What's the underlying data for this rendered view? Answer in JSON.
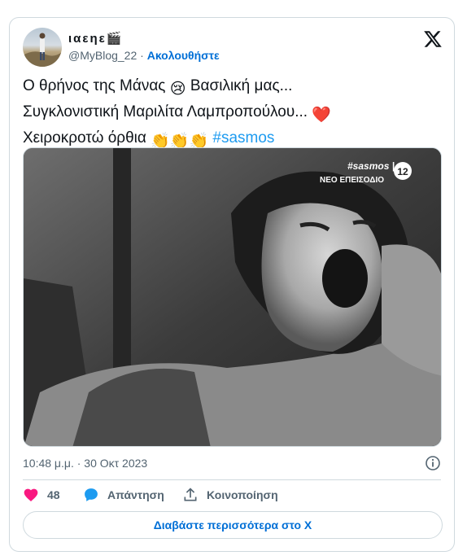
{
  "tweet": {
    "display_name": "ιαεηε🎬",
    "handle": "@MyBlog_22",
    "separator": " · ",
    "follow_label": "Ακολουθήστε",
    "text_line1": "Ο θρήνος της Μάνας ",
    "emoji1": "😢",
    "text_line1b": " Βασιλική μας...",
    "text_line2": "Συγκλονιστική Μαριλίτα Λαμπροπούλου... ",
    "emoji2": "❤️",
    "text_line3": "Χειροκροτώ όρθια ",
    "emoji3": "👏👏👏",
    "hashtag": "#sasmos",
    "timestamp": "10:48 μ.μ. · 30 Οκτ 2023"
  },
  "media": {
    "overlay_brand": "#sasmos |",
    "overlay_sub": "ΝΕΟ ΕΠΕΙΣΟΔΙΟ",
    "rating": "12"
  },
  "actions": {
    "like_count": "48",
    "reply_label": "Απάντηση",
    "share_label": "Κοινοποίηση"
  },
  "read_more_label": "Διαβάστε περισσότερα στο X",
  "colors": {
    "link": "#006fd6",
    "hashtag": "#1d9bf0",
    "like": "#f91880",
    "border": "#cfd9de",
    "muted": "#536471"
  }
}
